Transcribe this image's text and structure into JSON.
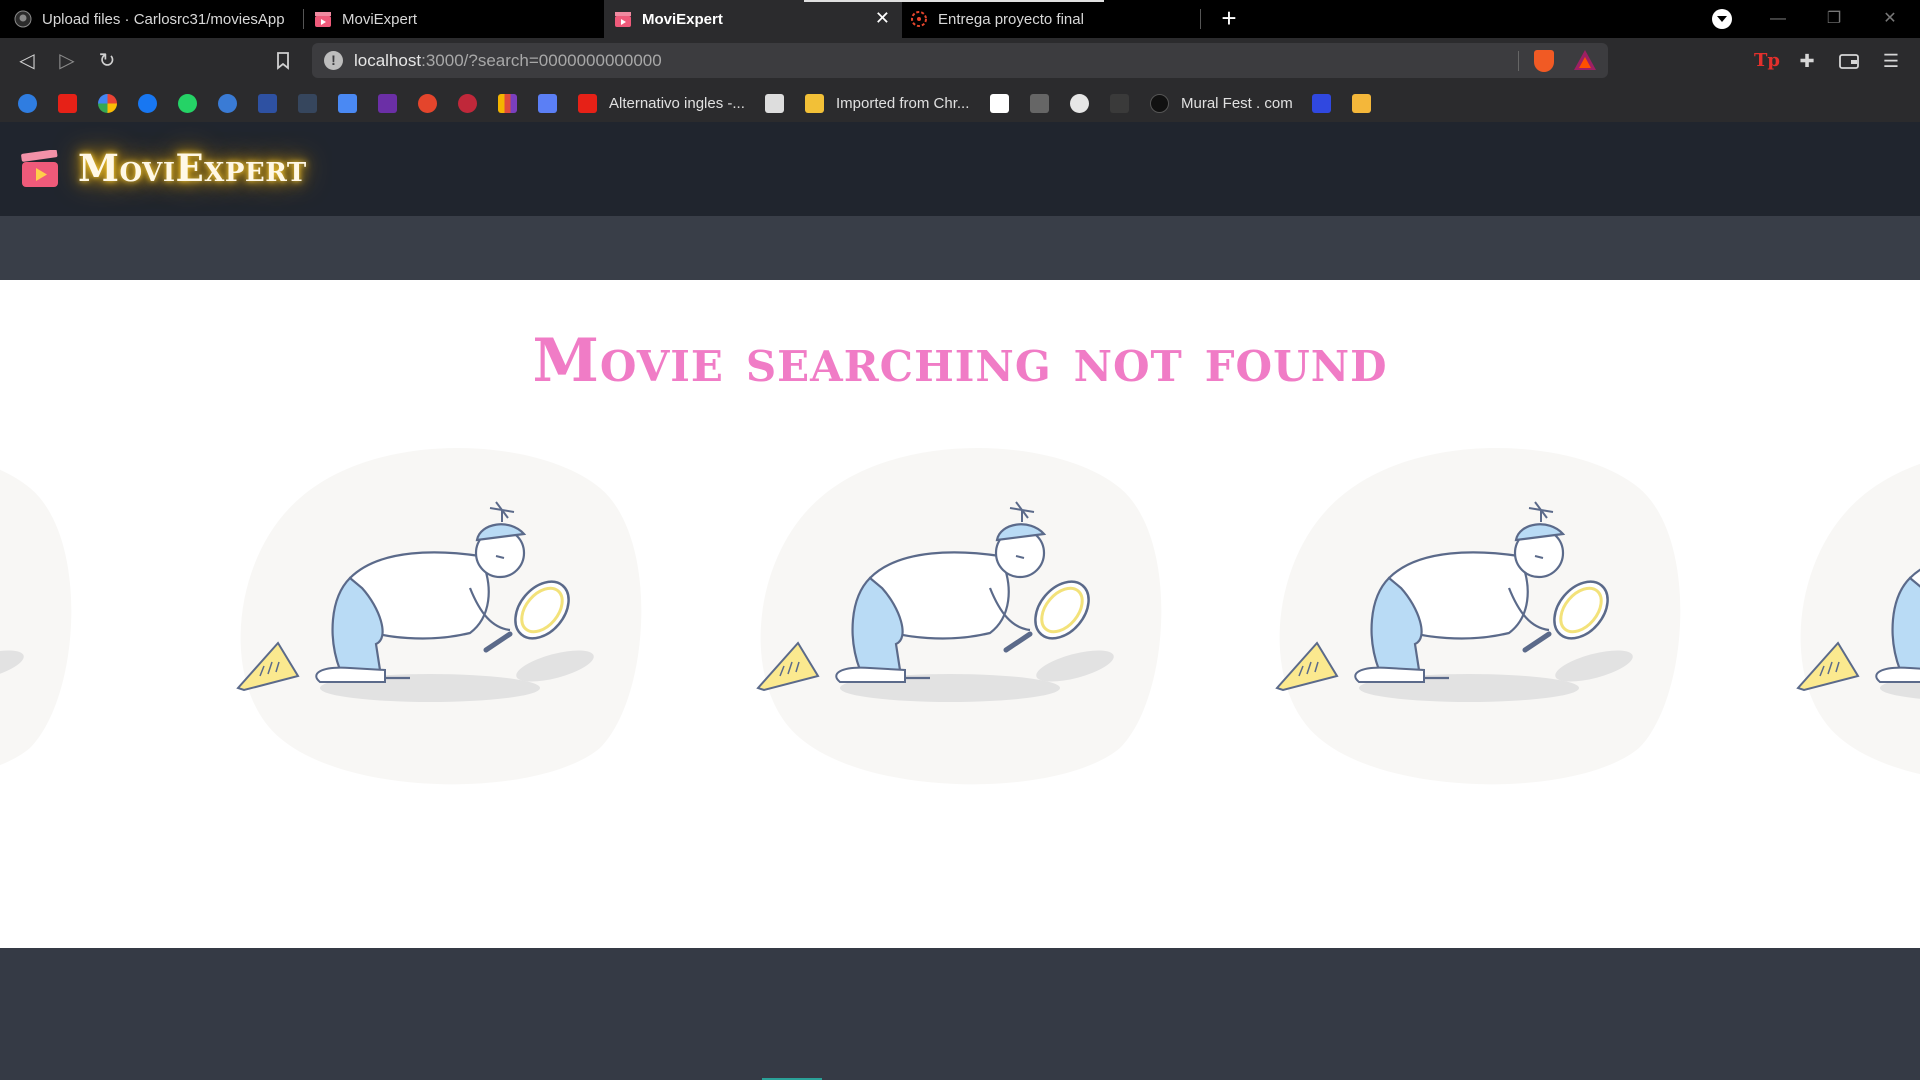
{
  "browser": {
    "tabs": [
      {
        "title": "Upload files · Carlosrc31/moviesApp",
        "icon": "github-icon"
      },
      {
        "title": "MoviExpert",
        "icon": "clapperboard-icon"
      },
      {
        "title": "MoviExpert",
        "icon": "clapperboard-icon",
        "active": true
      },
      {
        "title": "Entrega proyecto final",
        "icon": "canvas-icon"
      }
    ],
    "url_host": "localhost",
    "url_rest": ":3000/?search=0000000000000",
    "bookmarks_labeled": [
      {
        "label": "Alternativo ingles -...",
        "icon": "youtube-icon"
      },
      {
        "label": "Imported from Chr...",
        "icon": "folder-icon"
      },
      {
        "label": "Mural Fest . com",
        "icon": "mural-icon"
      }
    ],
    "brand_colors": {
      "brave": "#f15a24",
      "accent": "#9e1f63"
    }
  },
  "app": {
    "logo_text": "MoviExpert",
    "logo_glow": "#f6b400",
    "message": "Movie searching not found",
    "message_color": "#f07cc6",
    "illustration": "person-searching-with-magnifier-icon"
  }
}
